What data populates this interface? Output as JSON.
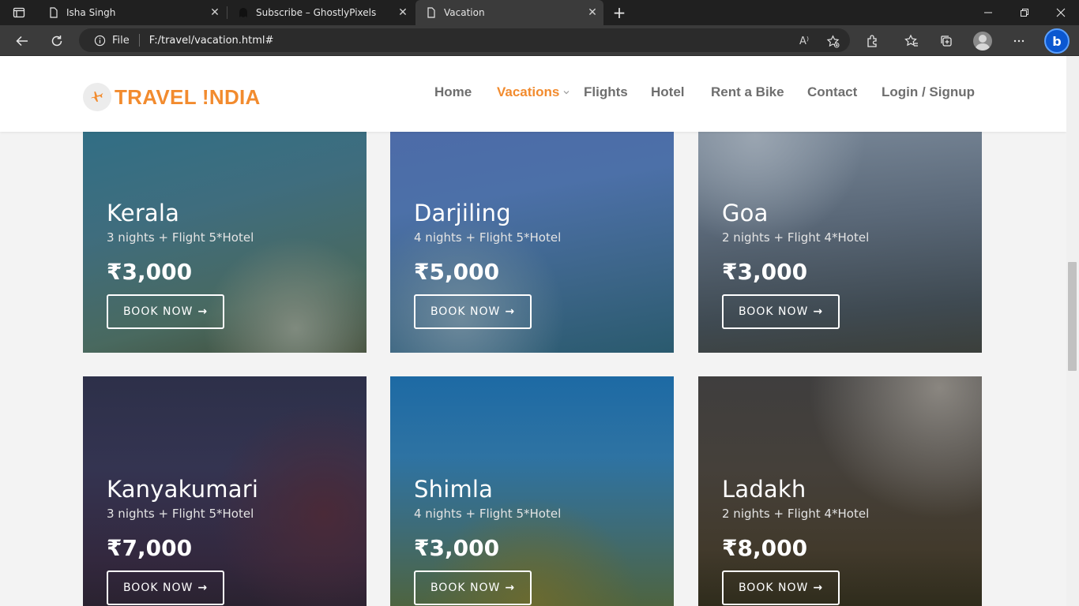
{
  "browser": {
    "tabs": [
      {
        "title": "Isha Singh",
        "favicon": "page-icon",
        "close": "✕"
      },
      {
        "title": "Subscribe – GhostlyPixels",
        "favicon": "ghost-icon",
        "close": "✕"
      },
      {
        "title": "Vacation",
        "favicon": "page-icon",
        "close": "✕",
        "active": true
      }
    ],
    "new_tab": "+",
    "address": {
      "scheme": "File",
      "url": "F:/travel/vacation.html#"
    },
    "read_aloud": "A⁾"
  },
  "site": {
    "logo_text": "TRAVEL !NDIA",
    "nav": [
      {
        "label": "Home"
      },
      {
        "label": "Vacations",
        "active": true
      },
      {
        "label": "Flights"
      },
      {
        "label": "Hotel"
      },
      {
        "label": "Rent a Bike"
      },
      {
        "label": "Contact"
      },
      {
        "label": "Login / Signup"
      }
    ],
    "accent_color": "#f28b2e",
    "book_label": "BOOK NOW",
    "book_arrow": "→"
  },
  "cards": [
    {
      "title": "Kerala",
      "subtitle": "3 nights + Flight 5*Hotel",
      "price": "₹3,000"
    },
    {
      "title": "Darjiling",
      "subtitle": "4 nights + Flight 5*Hotel",
      "price": "₹5,000"
    },
    {
      "title": "Goa",
      "subtitle": "2 nights + Flight 4*Hotel",
      "price": "₹3,000"
    },
    {
      "title": "Kanyakumari",
      "subtitle": "3 nights + Flight 5*Hotel",
      "price": "₹7,000"
    },
    {
      "title": "Shimla",
      "subtitle": "4 nights + Flight 5*Hotel",
      "price": "₹3,000"
    },
    {
      "title": "Ladakh",
      "subtitle": "2 nights + Flight 4*Hotel",
      "price": "₹8,000"
    }
  ]
}
